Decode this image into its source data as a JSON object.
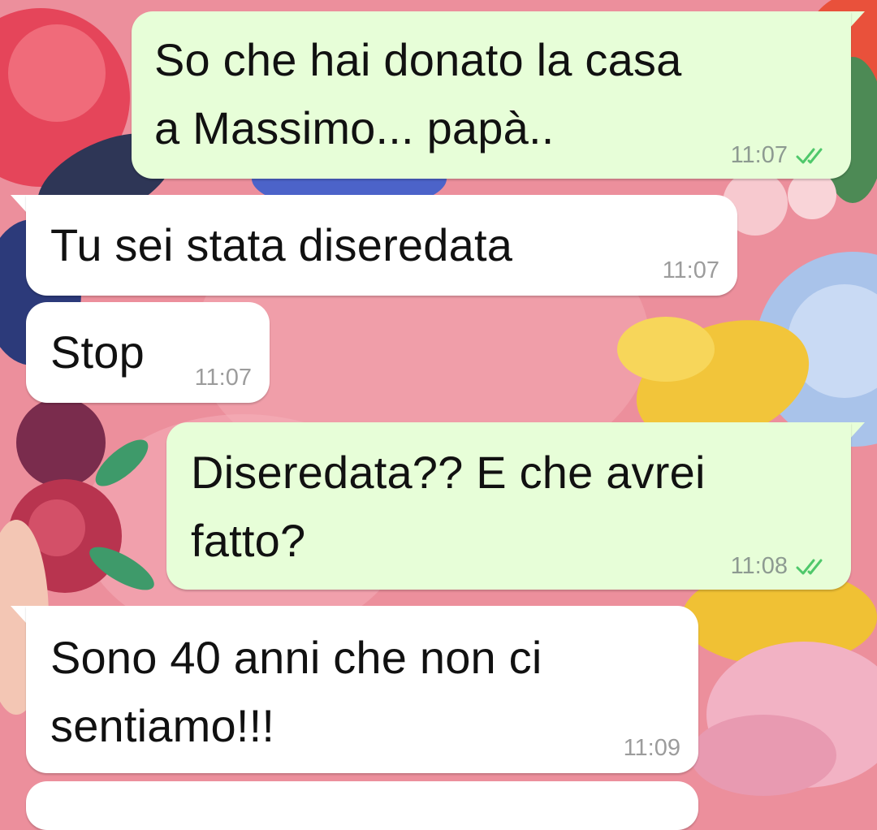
{
  "messages": [
    {
      "direction": "outgoing",
      "text": "So che hai donato la casa\na Massimo... papà..",
      "time": "11:07",
      "status_icon": "double-check-icon",
      "status_color": "#4fc86b"
    },
    {
      "direction": "incoming",
      "text": "Tu sei stata diseredata",
      "time": "11:07"
    },
    {
      "direction": "incoming",
      "text": "Stop",
      "time": "11:07"
    },
    {
      "direction": "outgoing",
      "text": "Diseredata?? E che avrei\nfatto?",
      "time": "11:08",
      "status_icon": "double-check-icon",
      "status_color": "#4fc86b"
    },
    {
      "direction": "incoming",
      "text": "Sono 40 anni che non ci\nsentiamo!!!",
      "time": "11:09"
    }
  ],
  "colors": {
    "outgoing_bubble": "#e7fed8",
    "incoming_bubble": "#ffffff",
    "wallpaper": "#ec8f9c"
  }
}
